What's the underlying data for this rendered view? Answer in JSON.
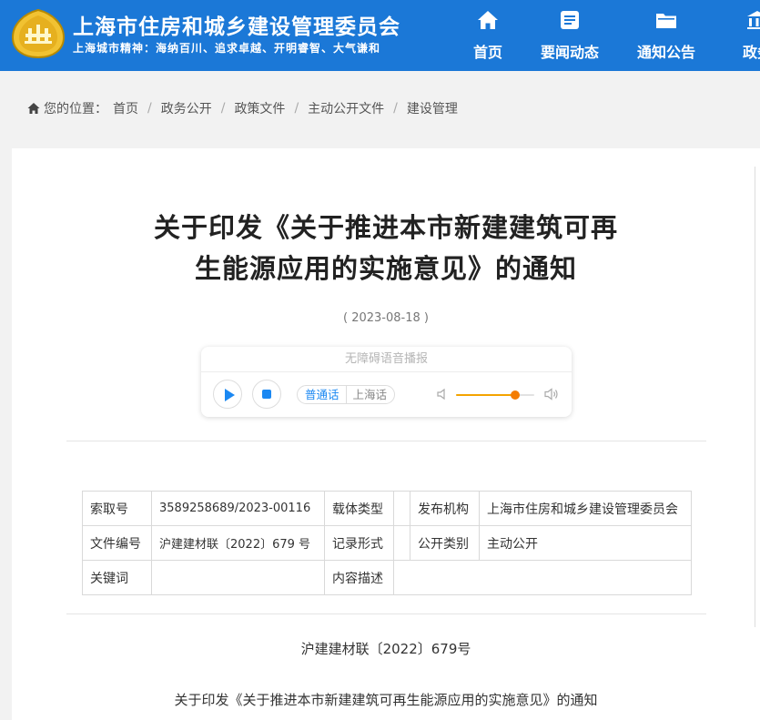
{
  "header": {
    "title": "上海市住房和城乡建设管理委员会",
    "motto": "上海城市精神：海纳百川、追求卓越、开明睿智、大气谦和",
    "logo_icon": "seal-logo-icon",
    "nav": [
      {
        "label": "首页",
        "icon": "home-icon"
      },
      {
        "label": "要闻动态",
        "icon": "news-icon"
      },
      {
        "label": "通知公告",
        "icon": "folder-icon"
      },
      {
        "label": "政务",
        "icon": "gov-icon"
      }
    ],
    "background_color": "#1b78d7"
  },
  "breadcrumb": {
    "prefix": "您的位置：",
    "items": [
      "首页",
      "政务公开",
      "政策文件",
      "主动公开文件",
      "建设管理"
    ],
    "separator": "/"
  },
  "article": {
    "title_line1": "关于印发《关于推进本市新建建筑可再",
    "title_line2": "生能源应用的实施意见》的通知",
    "date": "( 2023-08-18 )",
    "doc_number": "沪建建材联〔2022〕679号",
    "subtitle": "关于印发《关于推进本市新建建筑可再生能源应用的实施意见》的通知"
  },
  "player": {
    "heading": "无障碍语音播报",
    "lang_mandarin": "普通话",
    "lang_shanghai": "上海话",
    "volume": 0.76,
    "accent_color": "#1b88f2",
    "volume_color": "#f47c00"
  },
  "meta": {
    "rows": [
      [
        "索取号",
        "3589258689/2023-00116",
        "载体类型",
        "",
        "发布机构",
        "上海市住房和城乡建设管理委员会"
      ],
      [
        "文件编号",
        "沪建建材联〔2022〕679 号",
        "记录形式",
        "",
        "公开类别",
        "主动公开"
      ],
      [
        "关键词",
        "",
        "内容描述",
        "",
        "",
        ""
      ]
    ]
  }
}
